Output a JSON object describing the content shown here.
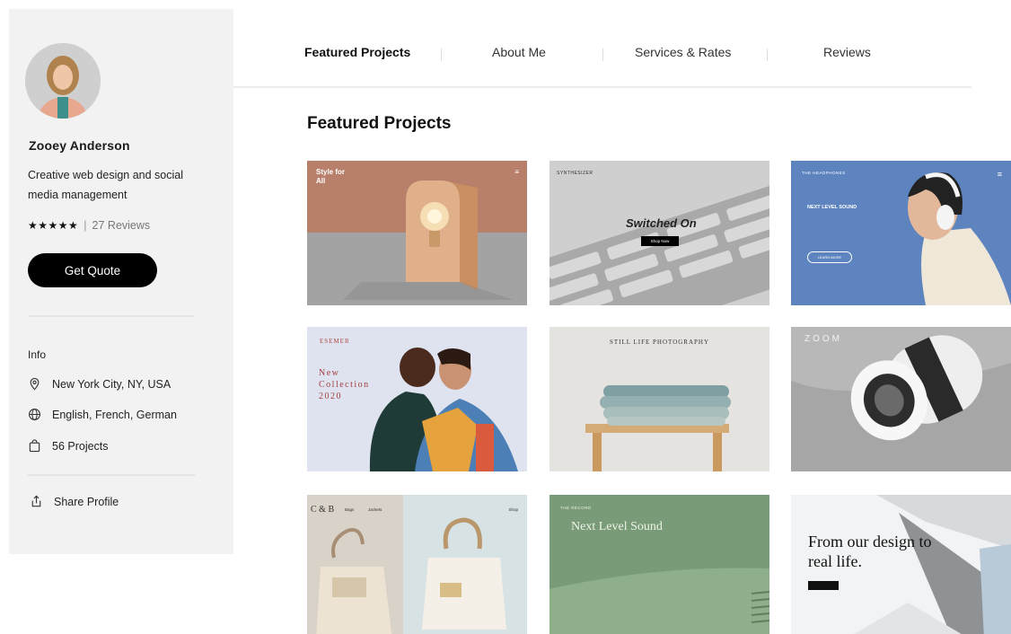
{
  "profile": {
    "name": "Zooey Anderson",
    "tagline": "Creative web design and social media management",
    "stars": "★★★★★",
    "rating_separator": "|",
    "reviews": "27 Reviews",
    "quote_button": "Get Quote"
  },
  "info": {
    "heading": "Info",
    "location": "New York City, NY, USA",
    "languages": "English, French, German",
    "projects": "56 Projects",
    "share": "Share Profile"
  },
  "nav": {
    "tabs": [
      {
        "label": "Featured Projects",
        "active": true
      },
      {
        "label": "About Me",
        "active": false
      },
      {
        "label": "Services & Rates",
        "active": false
      },
      {
        "label": "Reviews",
        "active": false
      }
    ]
  },
  "main": {
    "title": "Featured Projects"
  },
  "projects": [
    {
      "title": "Style for All"
    },
    {
      "brand": "SYNTHESIZER",
      "title": "Switched On",
      "button": "Shop Now"
    },
    {
      "brand": "THE HEADPHONES",
      "title": "NEXT LEVEL SOUND",
      "button": "LEARN MORE"
    },
    {
      "brand": "ESEMER",
      "title": "New Collection 2020"
    },
    {
      "title": "STILL LIFE PHOTOGRAPHY"
    },
    {
      "title": "ZOOM"
    },
    {
      "brand": "C & B",
      "menu1": "Bags",
      "menu2": "Jackets",
      "menu3": "Shop"
    },
    {
      "brand": "THE RECORD",
      "title": "Next Level Sound"
    },
    {
      "title": "From our design to real life."
    }
  ],
  "colors": {
    "sidebar_bg": "#f2f2f2",
    "button_bg": "#000000",
    "tile1_bg": "#b8806a",
    "tile3_bg": "#5d84bf",
    "tile8_bg": "#7a9b78"
  }
}
